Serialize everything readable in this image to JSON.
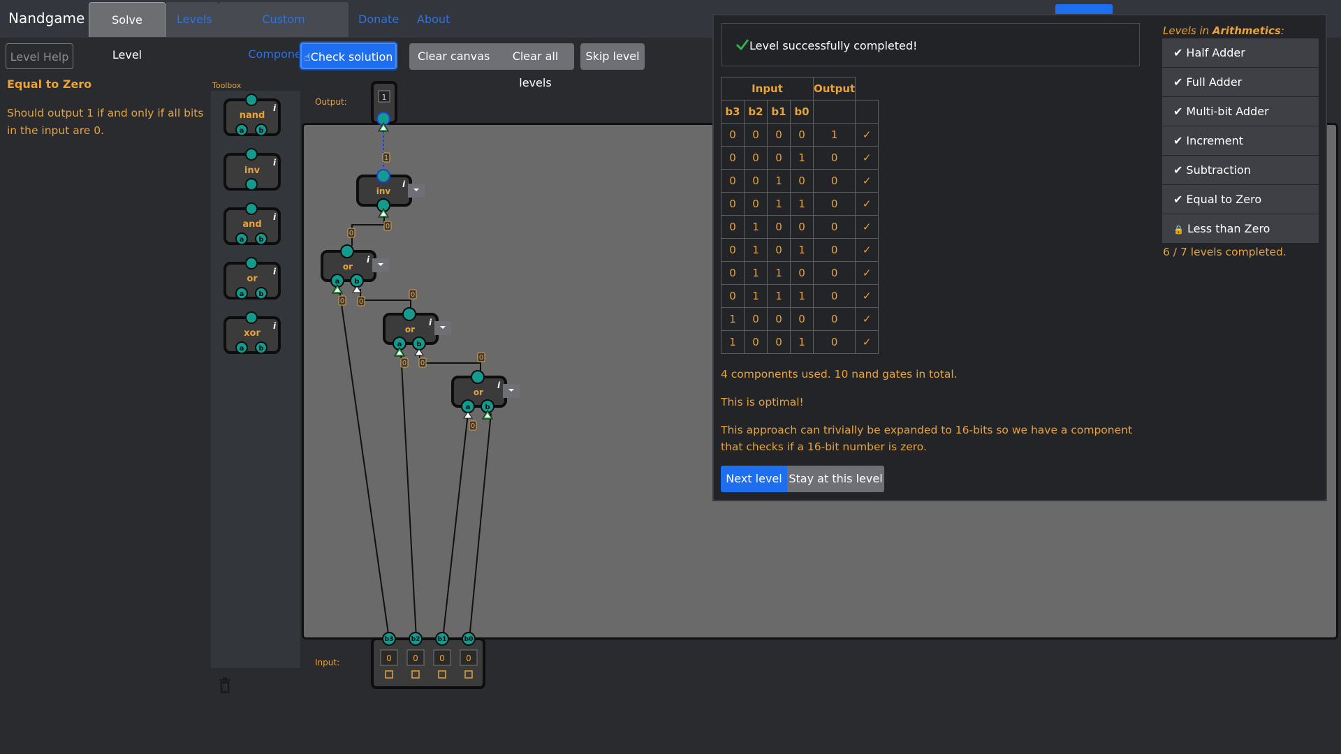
{
  "app": {
    "brand": "Nandgame"
  },
  "nav": {
    "tabs": [
      "Solve Level",
      "Levels",
      "Custom Components"
    ],
    "links": [
      "Donate",
      "About"
    ]
  },
  "left": {
    "help_label": "Level Help",
    "title": "Equal to Zero",
    "description": "Should output 1 if and only if all bits in the input are 0."
  },
  "toolbar": {
    "check": "Check solution",
    "clear_canvas": "Clear canvas",
    "clear_all": "Clear all levels",
    "skip": "Skip level"
  },
  "toolbox": {
    "label": "Toolbox",
    "items": [
      "nand",
      "inv",
      "and",
      "or",
      "xor"
    ]
  },
  "canvas": {
    "output_label": "Output:",
    "input_label": "Input:",
    "output_value": "1",
    "input_pins": [
      "b3",
      "b2",
      "b1",
      "b0"
    ],
    "input_values": [
      "0",
      "0",
      "0",
      "0"
    ],
    "components": [
      {
        "type": "inv",
        "in": "1",
        "out": "0"
      },
      {
        "type": "or",
        "out": "0",
        "a": "0",
        "b": "0"
      },
      {
        "type": "or",
        "out": "0",
        "a": "0",
        "b": "0"
      },
      {
        "type": "or",
        "out": "0",
        "a": "0",
        "b": "0"
      }
    ],
    "wire_values": [
      "1",
      "0",
      "0",
      "0",
      "0",
      "0",
      "0",
      "0",
      "0",
      "0"
    ]
  },
  "result": {
    "banner": "Level successfully completed!",
    "headers": {
      "input": "Input",
      "output": "Output"
    },
    "columns": [
      "b3",
      "b2",
      "b1",
      "b0"
    ],
    "rows": [
      [
        "0",
        "0",
        "0",
        "0",
        "1",
        "✓"
      ],
      [
        "0",
        "0",
        "0",
        "1",
        "0",
        "✓"
      ],
      [
        "0",
        "0",
        "1",
        "0",
        "0",
        "✓"
      ],
      [
        "0",
        "0",
        "1",
        "1",
        "0",
        "✓"
      ],
      [
        "0",
        "1",
        "0",
        "0",
        "0",
        "✓"
      ],
      [
        "0",
        "1",
        "0",
        "1",
        "0",
        "✓"
      ],
      [
        "0",
        "1",
        "1",
        "0",
        "0",
        "✓"
      ],
      [
        "0",
        "1",
        "1",
        "1",
        "0",
        "✓"
      ],
      [
        "1",
        "0",
        "0",
        "0",
        "0",
        "✓"
      ],
      [
        "1",
        "0",
        "0",
        "1",
        "0",
        "✓"
      ]
    ],
    "summary": "4 components used. 10 nand gates in total.",
    "optimal": "This is optimal!",
    "note": "This approach can trivially be expanded to 16-bits so we have a component that checks if a 16-bit number is zero.",
    "next": "Next level",
    "stay": "Stay at this level"
  },
  "levels": {
    "heading_prefix": "Levels in ",
    "heading_group": "Arithmetics",
    "heading_suffix": ":",
    "items": [
      {
        "label": "Half Adder",
        "status": "done"
      },
      {
        "label": "Full Adder",
        "status": "done"
      },
      {
        "label": "Multi-bit Adder",
        "status": "done"
      },
      {
        "label": "Increment",
        "status": "done"
      },
      {
        "label": "Subtraction",
        "status": "done"
      },
      {
        "label": "Equal to Zero",
        "status": "done"
      },
      {
        "label": "Less than Zero",
        "status": "locked"
      }
    ],
    "progress": "6 / 7 levels completed."
  },
  "colors": {
    "accent": "#e8a33a",
    "primary": "#1e6ef0",
    "success": "#2fb24a",
    "pin": "#159a8e"
  }
}
